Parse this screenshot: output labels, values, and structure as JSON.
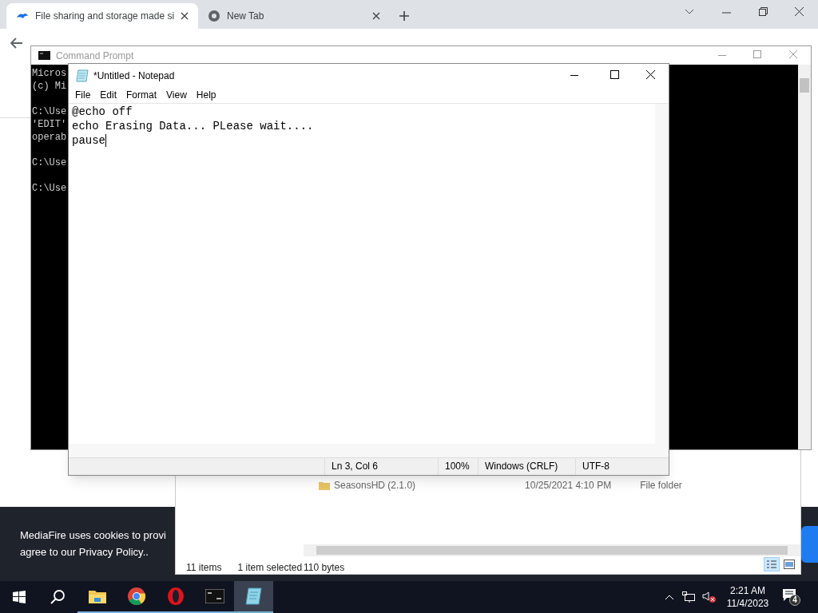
{
  "browser": {
    "tabs": [
      {
        "title": "File sharing and storage made si",
        "selected": true
      },
      {
        "title": "New Tab",
        "selected": false
      }
    ]
  },
  "cookie_banner": {
    "lines": [
      "MediaFire uses cookies to provi",
      "agree to our Privacy Policy.."
    ]
  },
  "explorer": {
    "rows": [
      {
        "name": "SeasonsHD (2.1.0)",
        "date": "10/25/2021 4:10 PM",
        "type": "File folder"
      }
    ],
    "status": {
      "items": "11 items",
      "selected": "1 item selected",
      "size": "110 bytes"
    }
  },
  "cmd": {
    "title": "Command Prompt",
    "blocks": [
      [
        "Micros",
        "(c) Mi"
      ],
      [
        "C:\\Use",
        "'EDIT'",
        "operab"
      ],
      [
        "C:\\Use"
      ],
      [
        "C:\\Use"
      ]
    ]
  },
  "notepad": {
    "title": "*Untitled - Notepad",
    "menu": [
      "File",
      "Edit",
      "Format",
      "View",
      "Help"
    ],
    "lines": [
      "@echo off",
      "echo Erasing Data... PLease wait....",
      "pause"
    ],
    "status": [
      "Ln 3, Col 6",
      "100%",
      "Windows (CRLF)",
      "UTF-8"
    ]
  },
  "taskbar": {
    "apps": [
      {
        "kind": "folder",
        "active": false
      },
      {
        "kind": "chrome",
        "active": false
      },
      {
        "kind": "opera",
        "active": false
      },
      {
        "kind": "terminal",
        "active": false
      },
      {
        "kind": "notepad",
        "active": true
      }
    ],
    "time": "2:21 AM",
    "date": "11/4/2023",
    "notifications": "4"
  }
}
